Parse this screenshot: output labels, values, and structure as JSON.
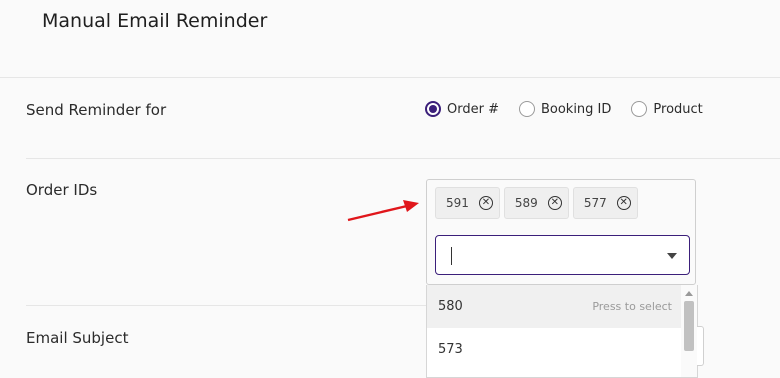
{
  "page": {
    "title": "Manual Email Reminder"
  },
  "form": {
    "send_reminder_label": "Send Reminder for",
    "radio_options": [
      {
        "label": "Order #",
        "checked": true
      },
      {
        "label": "Booking ID",
        "checked": false
      },
      {
        "label": "Product",
        "checked": false
      }
    ],
    "order_ids_label": "Order IDs",
    "selected_ids": [
      "591",
      "589",
      "577"
    ],
    "chip_remove_glyph": "✕",
    "search_value": "",
    "dropdown_options": [
      {
        "value": "580",
        "hint": "Press to select"
      },
      {
        "value": "573",
        "hint": ""
      }
    ],
    "email_subject_label": "Email Subject"
  },
  "colors": {
    "accent": "#3b1f7a",
    "arrow": "#e0161b"
  }
}
